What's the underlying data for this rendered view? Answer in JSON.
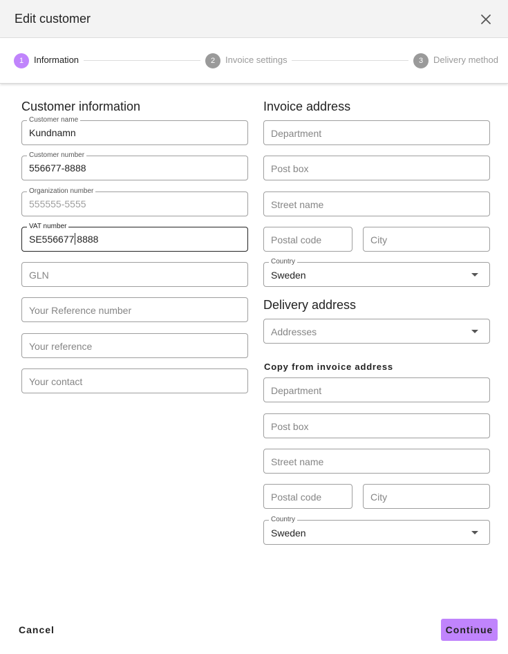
{
  "dialog": {
    "title": "Edit customer",
    "close_icon": "close-icon"
  },
  "stepper": {
    "steps": [
      {
        "number": "1",
        "label": "Information",
        "state": "active"
      },
      {
        "number": "2",
        "label": "Invoice settings",
        "state": "inactive"
      },
      {
        "number": "3",
        "label": "Delivery method",
        "state": "inactive"
      }
    ]
  },
  "customer_info": {
    "title": "Customer information",
    "customer_name": {
      "label": "Customer name",
      "value": "Kundnamn"
    },
    "customer_number": {
      "label": "Customer number",
      "value": "556677-8888"
    },
    "organization_number": {
      "label": "Organization number",
      "value": "555555-5555"
    },
    "vat_number": {
      "label": "VAT number",
      "value": "SE556677 8888"
    },
    "gln": {
      "placeholder": "GLN"
    },
    "your_reference_number": {
      "placeholder": "Your Reference number"
    },
    "your_reference": {
      "placeholder": "Your reference"
    },
    "your_contact": {
      "placeholder": "Your contact"
    }
  },
  "invoice_address": {
    "title": "Invoice address",
    "department": {
      "placeholder": "Department"
    },
    "post_box": {
      "placeholder": "Post box"
    },
    "street_name": {
      "placeholder": "Street name"
    },
    "postal_code": {
      "placeholder": "Postal code"
    },
    "city": {
      "placeholder": "City"
    },
    "country": {
      "label": "Country",
      "value": "Sweden"
    }
  },
  "delivery_address": {
    "title": "Delivery address",
    "addresses": {
      "placeholder": "Addresses"
    },
    "copy_title": "Copy from invoice address",
    "department": {
      "placeholder": "Department"
    },
    "post_box": {
      "placeholder": "Post box"
    },
    "street_name": {
      "placeholder": "Street name"
    },
    "postal_code": {
      "placeholder": "Postal code"
    },
    "city": {
      "placeholder": "City"
    },
    "country": {
      "label": "Country",
      "value": "Sweden"
    }
  },
  "footer": {
    "cancel_label": "Cancel",
    "continue_label": "Continue"
  },
  "colors": {
    "accent": "#c084fc",
    "inactive_step": "#9a9a9a",
    "header_bg": "#f3f3f3"
  }
}
